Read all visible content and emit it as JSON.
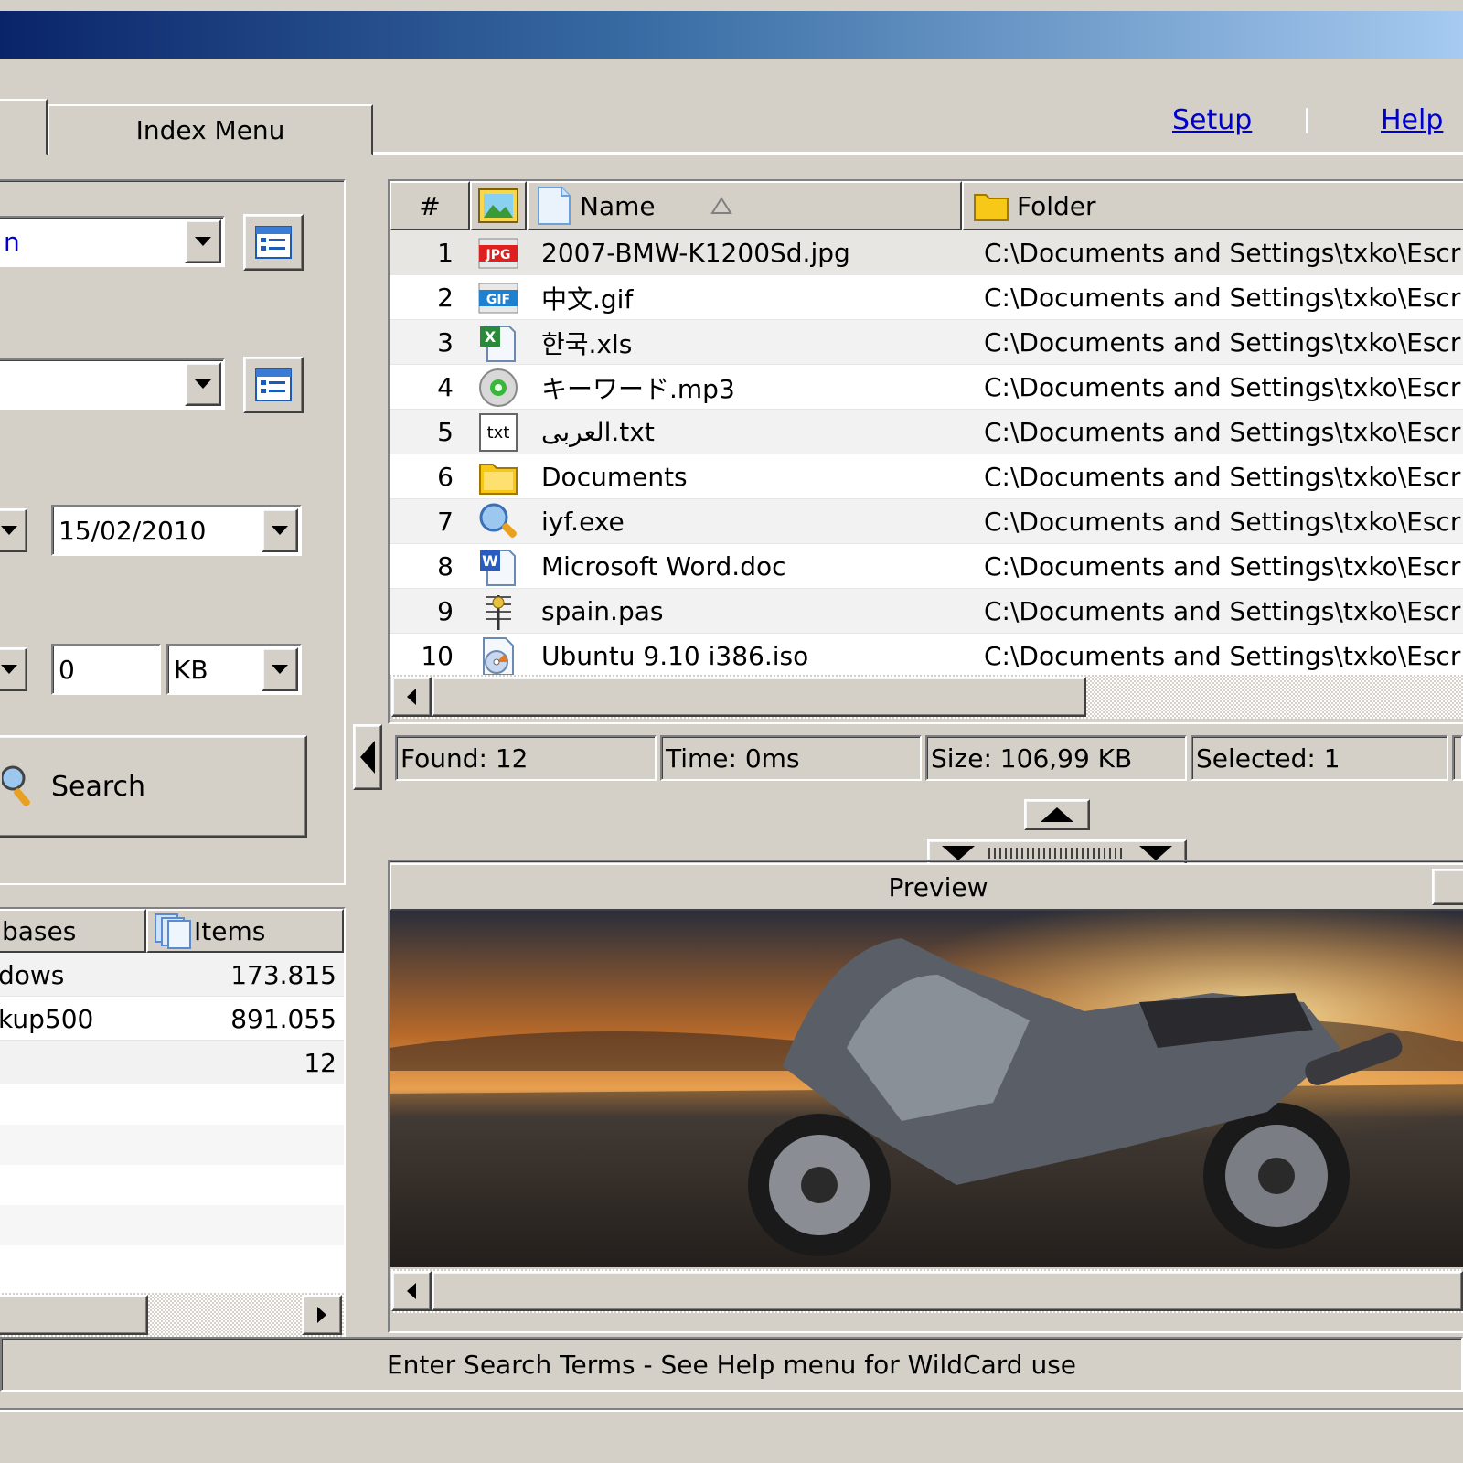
{
  "tabs": {
    "index_menu": "Index Menu"
  },
  "links": {
    "setup": "Setup",
    "help": "Help"
  },
  "search_panel": {
    "date_to": "15/02/2010",
    "size_value": "0",
    "size_unit": "KB",
    "search_button": "Search"
  },
  "databases": {
    "headers": [
      "bases",
      "Items"
    ],
    "rows": [
      {
        "name": "dows",
        "items": "173.815"
      },
      {
        "name": "kup500",
        "items": "891.055"
      },
      {
        "name": "",
        "items": "12"
      }
    ]
  },
  "results": {
    "headers": {
      "num": "#",
      "name": "Name",
      "folder": "Folder"
    },
    "rows": [
      {
        "num": "1",
        "name": "2007-BMW-K1200Sd.jpg",
        "folder": "C:\\Documents and Settings\\txko\\Escritorio",
        "icon": "jpg-file-icon"
      },
      {
        "num": "2",
        "name": "中文.gif",
        "folder": "C:\\Documents and Settings\\txko\\Escritorio",
        "icon": "gif-file-icon"
      },
      {
        "num": "3",
        "name": "한국.xls",
        "folder": "C:\\Documents and Settings\\txko\\Escritorio",
        "icon": "excel-file-icon"
      },
      {
        "num": "4",
        "name": "キーワード.mp3",
        "folder": "C:\\Documents and Settings\\txko\\Escritorio",
        "icon": "audio-file-icon"
      },
      {
        "num": "5",
        "name": "العربى.txt",
        "folder": "C:\\Documents and Settings\\txko\\Escritorio",
        "icon": "text-file-icon"
      },
      {
        "num": "6",
        "name": "Documents",
        "folder": "C:\\Documents and Settings\\txko\\Escritorio",
        "icon": "folder-icon"
      },
      {
        "num": "7",
        "name": "iyf.exe",
        "folder": "C:\\Documents and Settings\\txko\\Escritorio",
        "icon": "exe-search-icon"
      },
      {
        "num": "8",
        "name": "Microsoft Word.doc",
        "folder": "C:\\Documents and Settings\\txko\\Escritorio",
        "icon": "word-file-icon"
      },
      {
        "num": "9",
        "name": "spain.pas",
        "folder": "C:\\Documents and Settings\\txko\\Escritorio",
        "icon": "pascal-file-icon"
      },
      {
        "num": "10",
        "name": "Ubuntu 9.10 i386.iso",
        "folder": "C:\\Documents and Settings\\txko\\Escritorio",
        "icon": "disc-image-icon"
      }
    ]
  },
  "status_panels": {
    "found": "Found: 12",
    "time": "Time:   0ms",
    "size": "Size: 106,99 KB",
    "selected": "Selected: 1"
  },
  "preview": {
    "title": "Preview"
  },
  "status_bar": {
    "text": "Enter Search Terms - See Help menu for WildCard use"
  },
  "colors": {
    "face": "#d4d0c8",
    "title_start": "#0a246a",
    "title_end": "#a6caf0",
    "link": "#0000cc"
  }
}
